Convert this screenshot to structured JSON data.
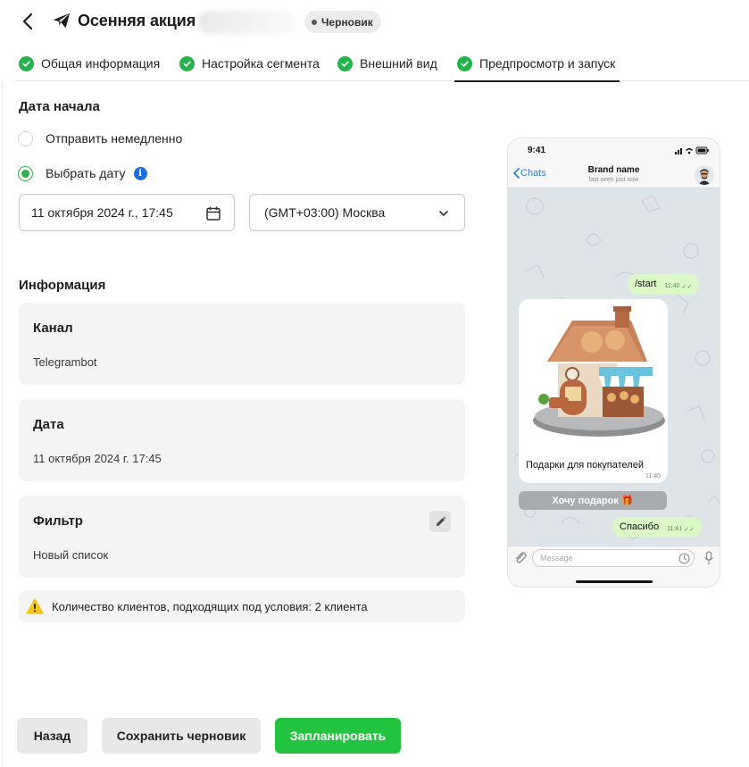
{
  "header": {
    "title": "Осенняя акция",
    "status": "Черновик"
  },
  "tabs": [
    {
      "label": "Общая информация",
      "completed": true,
      "active": false
    },
    {
      "label": "Настройка сегмента",
      "completed": true,
      "active": false
    },
    {
      "label": "Внешний вид",
      "completed": true,
      "active": false
    },
    {
      "label": "Предпросмотр и запуск",
      "completed": true,
      "active": true
    }
  ],
  "start_date": {
    "title": "Дата начала",
    "option_now": "Отправить немедленно",
    "option_pick": "Выбрать дату",
    "selected": "pick",
    "date_value": "11 октября 2024 г., 17:45",
    "timezone_value": "(GMT+03:00) Москва"
  },
  "info": {
    "title": "Информация",
    "channel_label": "Канал",
    "channel_value": "Telegrambot",
    "date_label": "Дата",
    "date_value": "11 октября 2024 г. 17:45",
    "filter_label": "Фильтр",
    "filter_value": "Новый список",
    "clients_note": "Количество клиентов, подходящих под условия: 2 клиента"
  },
  "buttons": {
    "back": "Назад",
    "save_draft": "Сохранить черновик",
    "schedule": "Запланировать"
  },
  "preview": {
    "time": "9:41",
    "back_label": "Chats",
    "bot_name": "Brand name",
    "bot_status": "last seen just now",
    "msg_start": "/start",
    "msg_start_time": "11:40",
    "media_caption": "Подарки для покупателей",
    "media_time": "11:40",
    "inline_button": "Хочу подарок 🎁",
    "msg_thanks": "Спасибо",
    "msg_thanks_time": "11:41",
    "input_placeholder": "Message"
  },
  "colors": {
    "accent_green": "#22c33f",
    "check_green": "#22b34a",
    "info_blue": "#1c6de0",
    "warning_yellow": "#f5c518",
    "telegram_blue": "#2f7fdb",
    "outgoing_bubble": "#dcf8c6"
  },
  "icons": {
    "back": "chevron-left-icon",
    "logo": "paper-plane-icon",
    "calendar": "calendar-icon",
    "dropdown": "chevron-down-icon",
    "edit": "pencil-icon",
    "warning": "warning-triangle-icon",
    "info": "info-icon"
  }
}
